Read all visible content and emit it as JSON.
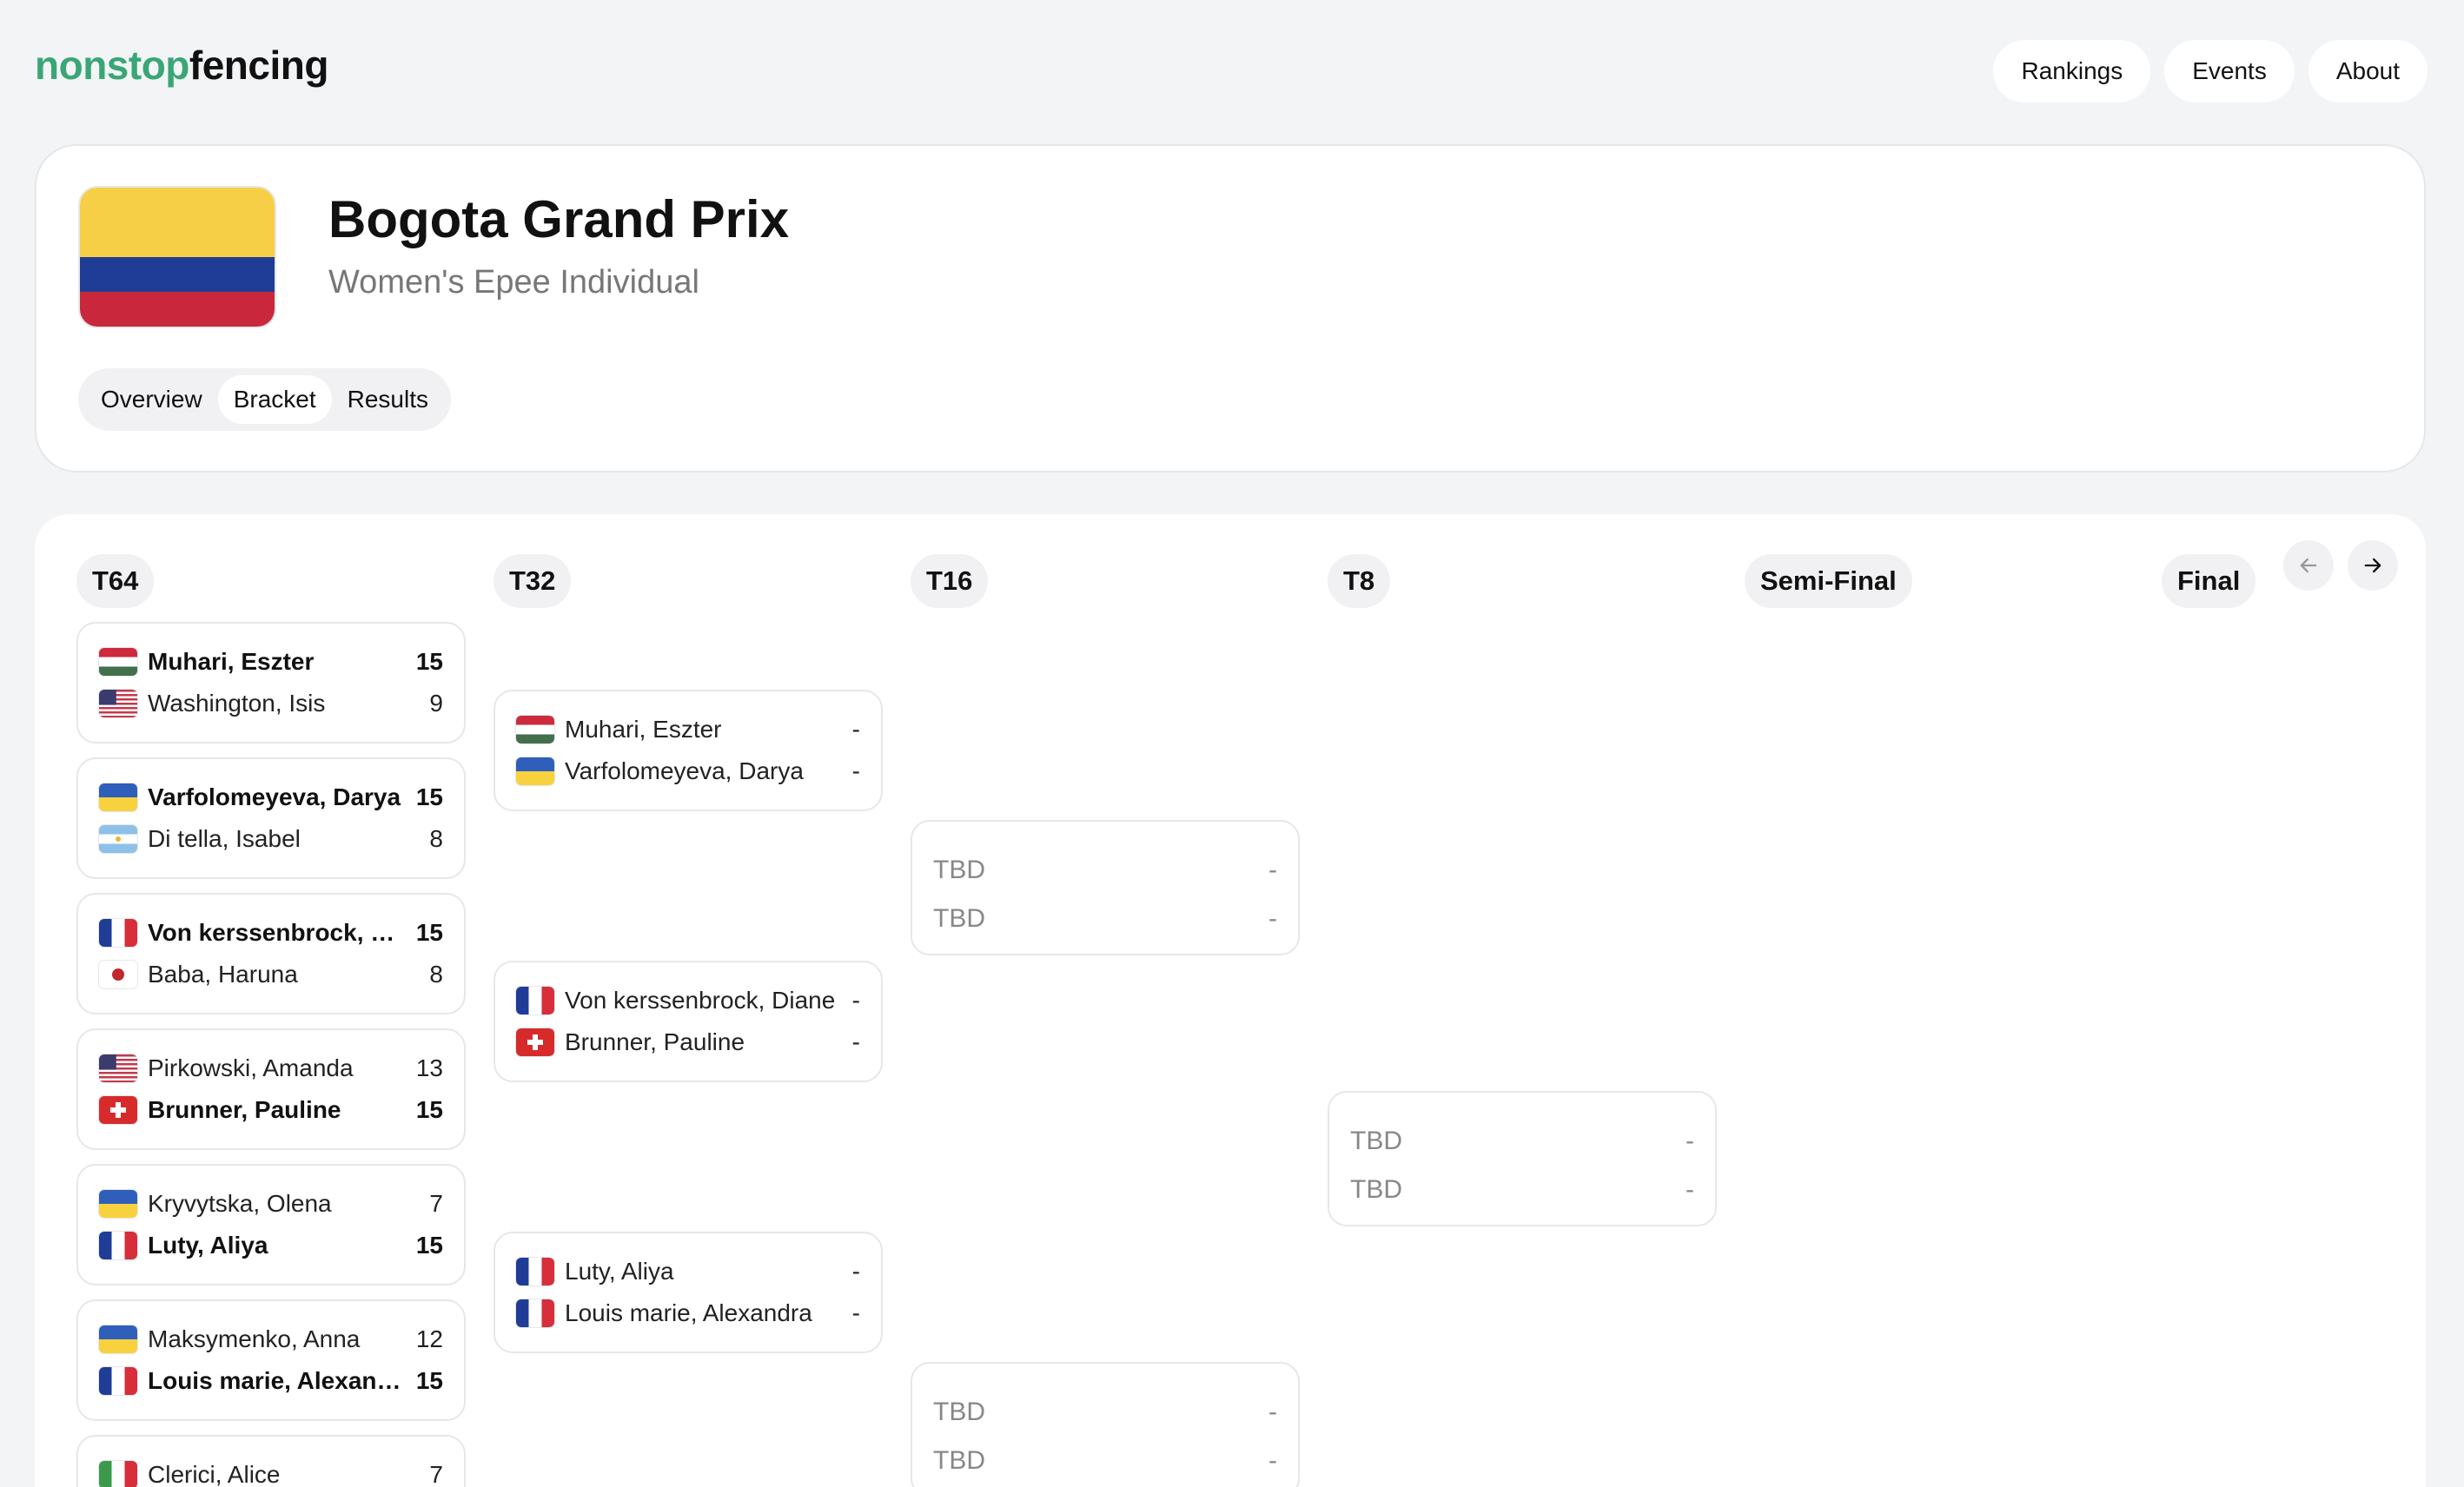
{
  "brand": {
    "part1": "nonstop",
    "part2": "fencing"
  },
  "nav": [
    "Rankings",
    "Events",
    "About"
  ],
  "event": {
    "title": "Bogota Grand Prix",
    "subtitle": "Women's Epee Individual",
    "flag": "colombia-flag",
    "tabs": [
      "Overview",
      "Bracket",
      "Results"
    ],
    "active_tab": "Bracket"
  },
  "rounds": [
    "T64",
    "T32",
    "T16",
    "T8",
    "Semi-Final",
    "Final"
  ],
  "arrows": {
    "prev": "arrow-left-icon",
    "next": "arrow-right-icon"
  },
  "t64": [
    {
      "a": {
        "flag": "hungary",
        "name": "Muhari, Eszter",
        "score": "15",
        "win": true
      },
      "b": {
        "flag": "usa",
        "name": "Washington, Isis",
        "score": "9",
        "win": false
      }
    },
    {
      "a": {
        "flag": "ukraine",
        "name": "Varfolomeyeva, Darya",
        "score": "15",
        "win": true
      },
      "b": {
        "flag": "argentina",
        "name": "Di tella, Isabel",
        "score": "8",
        "win": false
      }
    },
    {
      "a": {
        "flag": "france",
        "name": "Von kerssenbrock, Diane",
        "score": "15",
        "win": true
      },
      "b": {
        "flag": "japan",
        "name": "Baba, Haruna",
        "score": "8",
        "win": false
      }
    },
    {
      "a": {
        "flag": "usa",
        "name": "Pirkowski, Amanda",
        "score": "13",
        "win": false
      },
      "b": {
        "flag": "switzerland",
        "name": "Brunner, Pauline",
        "score": "15",
        "win": true
      }
    },
    {
      "a": {
        "flag": "ukraine",
        "name": "Kryvytska, Olena",
        "score": "7",
        "win": false
      },
      "b": {
        "flag": "france",
        "name": "Luty, Aliya",
        "score": "15",
        "win": true
      }
    },
    {
      "a": {
        "flag": "ukraine",
        "name": "Maksymenko, Anna",
        "score": "12",
        "win": false
      },
      "b": {
        "flag": "france",
        "name": "Louis marie, Alexandra",
        "score": "15",
        "win": true
      }
    },
    {
      "a": {
        "flag": "italy",
        "name": "Clerici, Alice",
        "score": "7",
        "win": false
      }
    }
  ],
  "t32": [
    {
      "a": {
        "flag": "hungary",
        "name": "Muhari, Eszter",
        "score": "-"
      },
      "b": {
        "flag": "ukraine",
        "name": "Varfolomeyeva, Darya",
        "score": "-"
      }
    },
    {
      "a": {
        "flag": "france",
        "name": "Von kerssenbrock, Diane",
        "score": "-"
      },
      "b": {
        "flag": "switzerland",
        "name": "Brunner, Pauline",
        "score": "-"
      }
    },
    {
      "a": {
        "flag": "france",
        "name": "Luty, Aliya",
        "score": "-"
      },
      "b": {
        "flag": "france",
        "name": "Louis marie, Alexandra",
        "score": "-"
      }
    }
  ],
  "t16": [
    {
      "a": {
        "name": "TBD",
        "score": "-"
      },
      "b": {
        "name": "TBD",
        "score": "-"
      }
    },
    {
      "a": {
        "name": "TBD",
        "score": "-"
      },
      "b": {
        "name": "TBD",
        "score": "-"
      }
    }
  ],
  "t8": [
    {
      "a": {
        "name": "TBD",
        "score": "-"
      },
      "b": {
        "name": "TBD",
        "score": "-"
      }
    }
  ]
}
